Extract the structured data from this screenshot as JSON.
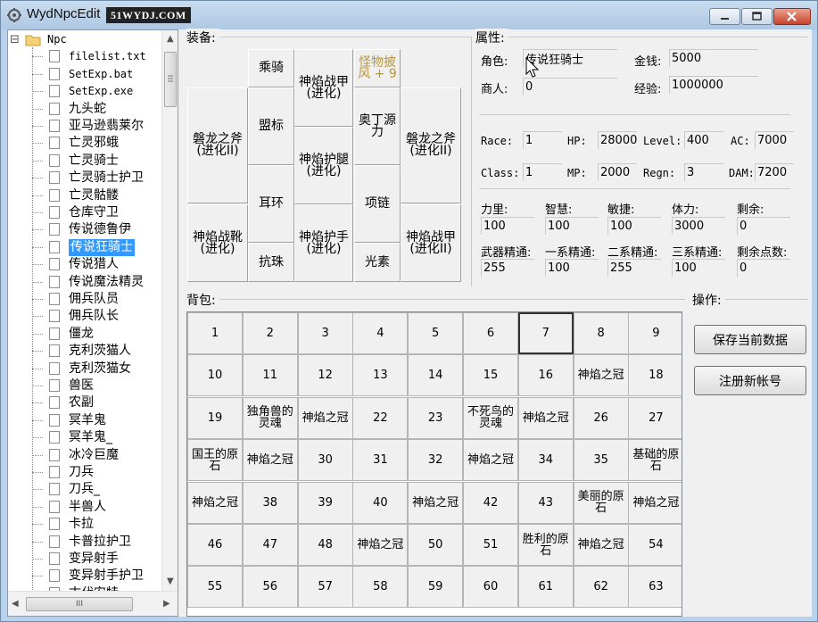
{
  "window": {
    "title": "WydNpcEdit",
    "watermark": "51WYDJ.COM"
  },
  "tree": {
    "root": "Npc",
    "root_toggle": "⊟",
    "items": [
      "filelist.txt",
      "SetExp.bat",
      "SetExp.exe",
      "九头蛇",
      "亚马逊翡莱尔",
      "亡灵邪蛾",
      "亡灵骑士",
      "亡灵骑士护卫",
      "亡灵骷髅",
      "仓库守卫",
      "传说德鲁伊",
      "传说狂骑士",
      "传说猎人",
      "传说魔法精灵",
      "佣兵队员",
      "佣兵队长",
      "僵龙",
      "克利茨猫人",
      "克利茨猫女",
      "兽医",
      "农副",
      "冥羊鬼",
      "冥羊鬼_",
      "冰冷巨魔",
      "刀兵",
      "刀兵_",
      "半兽人",
      "卡拉",
      "卡普拉护卫",
      "变异射手",
      "变异射手护卫",
      "古代安特"
    ],
    "selected_index": 11,
    "hscroll_grip": "III"
  },
  "equip": {
    "label": "装备:",
    "slots": {
      "mount": "乘骑",
      "armor_top": "神焰战甲(进化)",
      "cape": "怪物披风 + 9",
      "left_weapon": "磐龙之斧(进化II)",
      "emblem": "盟标",
      "legs": "神焰护腿(进化)",
      "ring_origin": "奥丁源力",
      "right_weapon": "磐龙之斧(进化II)",
      "earring": "耳环",
      "necklace": "项链",
      "gloves": "神焰护手(进化)",
      "boots": "神焰战靴(进化)",
      "bead": "抗珠",
      "element": "光素",
      "armor_bottom": "神焰战甲(进化II)"
    }
  },
  "attr": {
    "label": "属性:",
    "role_label": "角色:",
    "role": "传说狂骑士",
    "money_label": "金钱:",
    "money": "5000",
    "merchant_label": "商人:",
    "merchant": "0",
    "exp_label": "经验:",
    "exp": "1000000",
    "race_label": "Race:",
    "race": "1",
    "hp_label": "HP:",
    "hp": "28000",
    "level_label": "Level:",
    "level": "400",
    "ac_label": "AC:",
    "ac": "7000",
    "class_label": "Class:",
    "class": "1",
    "mp_label": "MP:",
    "mp": "2000",
    "regn_label": "Regn:",
    "regn": "3",
    "dam_label": "DAM:",
    "dam": "7200",
    "str_label": "力里:",
    "str": "100",
    "int_label": "智慧:",
    "int": "100",
    "dex_label": "敏捷:",
    "dex": "100",
    "con_label": "体力:",
    "con": "3000",
    "remain_label": "剩余:",
    "remain": "0",
    "weapon_label": "武器精通:",
    "weapon": "255",
    "s1_label": "一系精通:",
    "s1": "100",
    "s2_label": "二系精通:",
    "s2": "255",
    "s3_label": "三系精通:",
    "s3": "100",
    "sp_label": "剩余点数:",
    "sp": "0"
  },
  "bag": {
    "label": "背包:",
    "cells": [
      "1",
      "2",
      "3",
      "4",
      "5",
      "6",
      "7",
      "8",
      "9",
      "10",
      "11",
      "12",
      "13",
      "14",
      "15",
      "16",
      "神焰之冠",
      "18",
      "19",
      "独角兽的灵魂",
      "神焰之冠",
      "22",
      "23",
      "不死鸟的灵魂",
      "神焰之冠",
      "26",
      "27",
      "国王的原石",
      "神焰之冠",
      "30",
      "31",
      "32",
      "神焰之冠",
      "34",
      "35",
      "基础的原石",
      "神焰之冠",
      "38",
      "39",
      "40",
      "神焰之冠",
      "42",
      "43",
      "美丽的原石",
      "神焰之冠",
      "46",
      "47",
      "48",
      "神焰之冠",
      "50",
      "51",
      "胜利的原石",
      "神焰之冠",
      "54",
      "55",
      "56",
      "57",
      "58",
      "59",
      "60",
      "61",
      "62",
      "63"
    ],
    "focused_index": 6
  },
  "ops": {
    "label": "操作:",
    "save": "保存当前数据",
    "register": "注册新帐号"
  }
}
